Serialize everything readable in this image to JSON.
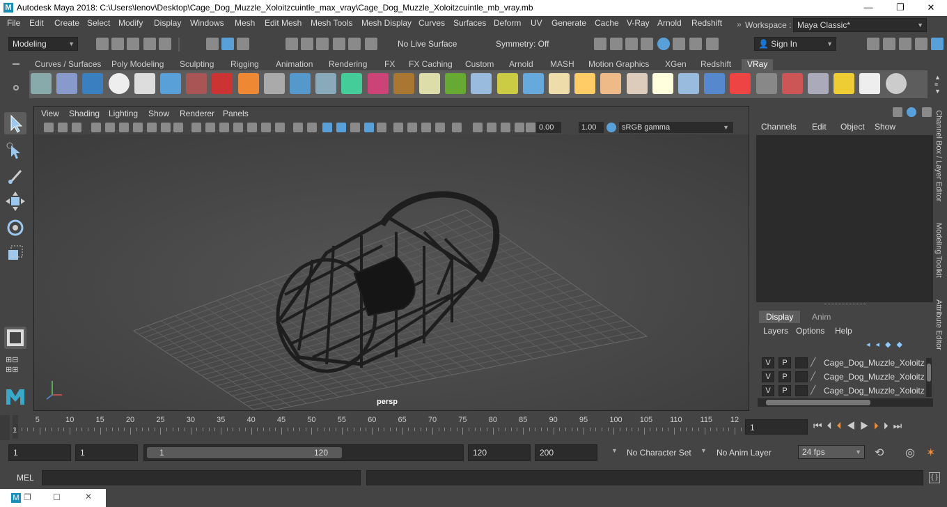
{
  "window": {
    "title": "Autodesk Maya 2018: C:\\Users\\lenov\\Desktop\\Cage_Dog_Muzzle_Xoloitzcuintle_max_vray\\Cage_Dog_Muzzle_Xoloitzcuintle_mb_vray.mb"
  },
  "menu": [
    "File",
    "Edit",
    "Create",
    "Select",
    "Modify",
    "Display",
    "Windows",
    "Mesh",
    "Edit Mesh",
    "Mesh Tools",
    "Mesh Display",
    "Curves",
    "Surfaces",
    "Deform",
    "UV",
    "Generate",
    "Cache",
    "V-Ray",
    "Arnold",
    "Redshift"
  ],
  "workspace": {
    "label": "Workspace :",
    "value": "Maya Classic*"
  },
  "statusline": {
    "mode": "Modeling",
    "live_surface": "No Live Surface",
    "symmetry": "Symmetry: Off",
    "sign_in": "Sign In"
  },
  "shelf_tabs": [
    "Curves / Surfaces",
    "Poly Modeling",
    "Sculpting",
    "Rigging",
    "Animation",
    "Rendering",
    "FX",
    "FX Caching",
    "Custom",
    "Arnold",
    "MASH",
    "Motion Graphics",
    "XGen",
    "Redshift",
    "VRay"
  ],
  "viewport": {
    "menu": [
      "View",
      "Shading",
      "Lighting",
      "Show",
      "Renderer",
      "Panels"
    ],
    "exposure": "0.00",
    "gamma": "1.00",
    "color_space": "sRGB gamma",
    "camera": "persp"
  },
  "channel_box": {
    "menu": [
      "Channels",
      "Edit",
      "Object",
      "Show"
    ]
  },
  "layer_editor": {
    "tabs": [
      "Display",
      "Anim"
    ],
    "menu": [
      "Layers",
      "Options",
      "Help"
    ],
    "layers": [
      {
        "v": "V",
        "p": "P",
        "name": "Cage_Dog_Muzzle_Xoloitzcuintle"
      },
      {
        "v": "V",
        "p": "P",
        "name": "Cage_Dog_Muzzle_Xoloitzcuintle"
      },
      {
        "v": "V",
        "p": "P",
        "name": "Cage_Dog_Muzzle_Xoloitzcuintle"
      }
    ]
  },
  "side_tabs": [
    "Channel Box / Layer Editor",
    "Modeling Toolkit",
    "Attribute Editor"
  ],
  "timeline": {
    "ticks": [
      "1",
      "5",
      "10",
      "15",
      "20",
      "25",
      "30",
      "35",
      "40",
      "45",
      "50",
      "55",
      "60",
      "65",
      "70",
      "75",
      "80",
      "85",
      "90",
      "95",
      "100",
      "105",
      "110",
      "115",
      "12"
    ],
    "current_frame": "1"
  },
  "range": {
    "start": "1",
    "playback_start": "1",
    "slider_start": "1",
    "slider_end": "120",
    "playback_end": "120",
    "end": "200",
    "character_set": "No Character Set",
    "anim_layer": "No Anim Layer",
    "fps": "24 fps"
  },
  "command": {
    "label": "MEL"
  },
  "colors": {
    "ui_bg": "#444444",
    "field_bg": "#2b2b2b",
    "accent": "#5aa0d8",
    "grid": "#5a5a5a"
  }
}
